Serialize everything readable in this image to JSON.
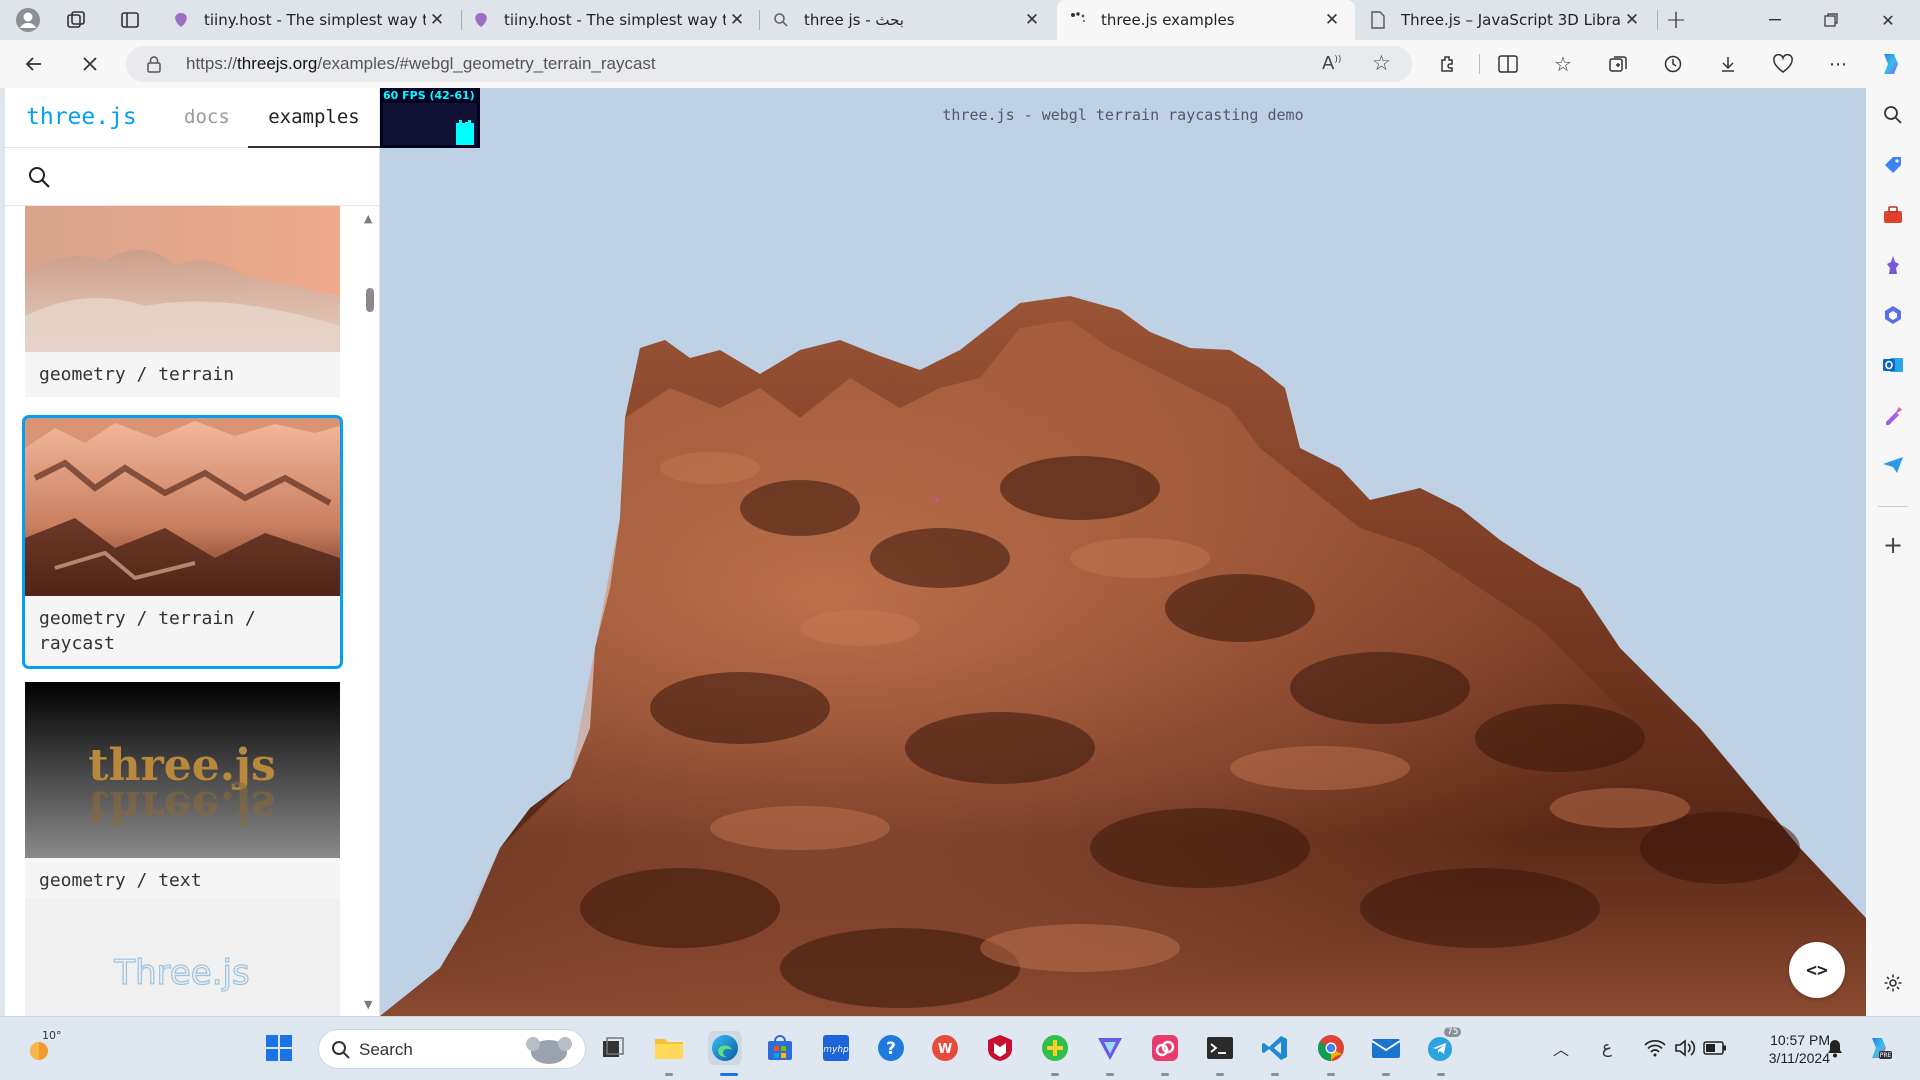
{
  "browser": {
    "tabs": [
      {
        "title": "tiiny.host - The simplest way to s",
        "icon": "tiiny-host-icon"
      },
      {
        "title": "tiiny.host - The simplest way to s",
        "icon": "tiiny-host-icon"
      },
      {
        "title": "three js - بحث",
        "icon": "search-icon"
      },
      {
        "title": "three.js examples",
        "icon": "loading-icon"
      },
      {
        "title": "Three.js – JavaScript 3D Library",
        "icon": "page-icon"
      }
    ],
    "active_tab_index": 3,
    "url_prefix": "https://",
    "url_host": "threejs.org",
    "url_path": "/examples/#webgl_geometry_terrain_raycast"
  },
  "sidebar": {
    "brand": "three.js",
    "nav_docs": "docs",
    "nav_examples": "examples",
    "cards": [
      {
        "label": "geometry / terrain"
      },
      {
        "label": "geometry / terrain / raycast"
      },
      {
        "label": "geometry / text"
      },
      {
        "label": ""
      }
    ],
    "selected_card_index": 1
  },
  "viewport": {
    "stats": "60 FPS (42-61)",
    "info": "three.js - webgl terrain raycasting demo",
    "code_button": "<>"
  },
  "thumbnails": {
    "text_logo": "three.js",
    "partial_logo": "Three.js"
  },
  "taskbar": {
    "weather_temp": "10°",
    "search_label": "Search",
    "time": "10:57 PM",
    "date": "3/11/2024",
    "lang": "ع",
    "telegram_badge": "75"
  }
}
